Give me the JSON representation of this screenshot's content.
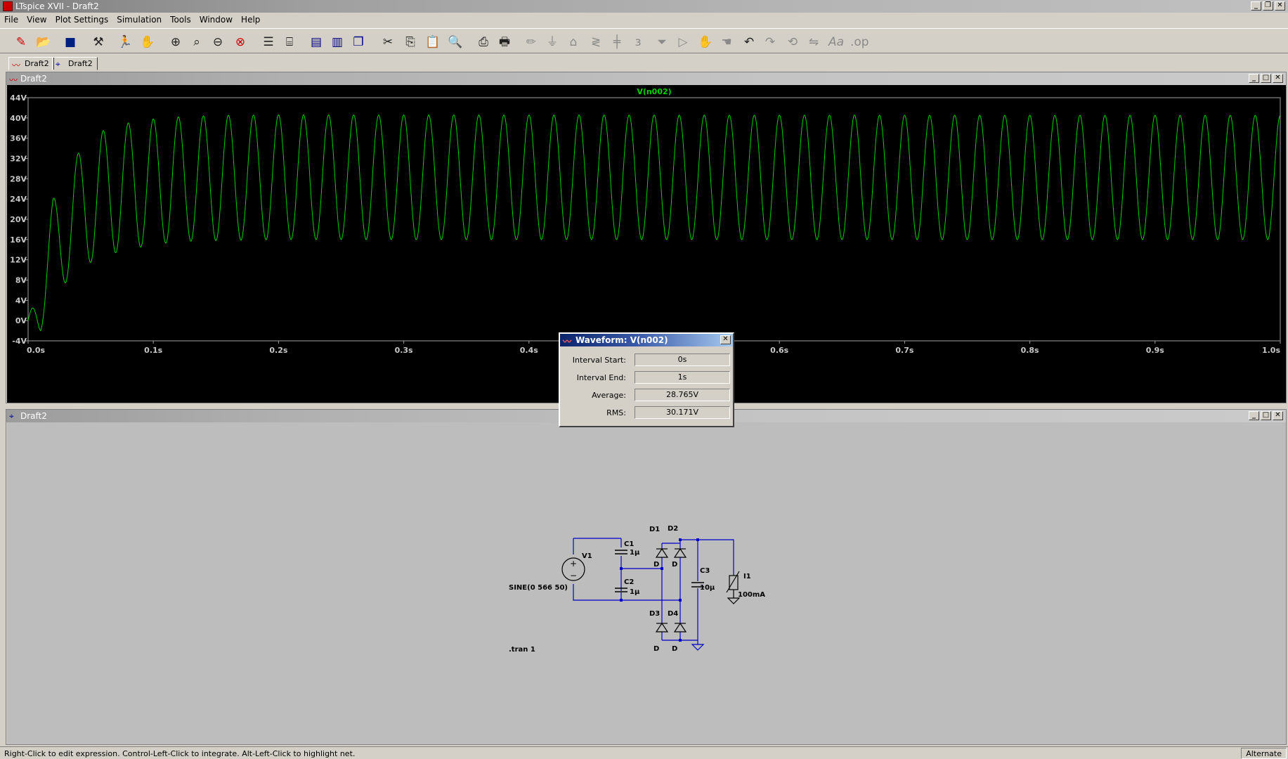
{
  "window": {
    "title": "LTspice XVII - Draft2"
  },
  "menu": [
    "File",
    "View",
    "Plot Settings",
    "Simulation",
    "Tools",
    "Window",
    "Help"
  ],
  "toolbar": {
    "icons": [
      "new-schematic-icon",
      "open-icon",
      "save-icon",
      "control-panel-icon",
      "run-icon",
      "halt-icon",
      "zoom-in-icon",
      "zoom-pan-icon",
      "zoom-out-icon",
      "zoom-cancel-icon",
      "autorange-icon",
      "add-trace-icon",
      "tile-horizontal-icon",
      "tile-vertical-icon",
      "cascade-icon",
      "cut-icon",
      "copy-icon",
      "paste-icon",
      "find-icon",
      "print-setup-icon",
      "print-icon",
      "draw-wire-icon",
      "ground-icon",
      "label-net-icon",
      "resistor-icon",
      "capacitor-icon",
      "inductor-icon",
      "diode-icon",
      "component-icon",
      "move-icon",
      "drag-icon",
      "undo-icon",
      "redo-icon",
      "rotate-icon",
      "mirror-icon",
      "text-icon",
      "spice-directive-icon"
    ]
  },
  "tabs": [
    {
      "label": "Draft2",
      "icon": "waveform-tab-icon"
    },
    {
      "label": "Draft2",
      "icon": "schematic-tab-icon"
    }
  ],
  "plot_pane": {
    "title": "Draft2"
  },
  "schematic_pane": {
    "title": "Draft2"
  },
  "chart_data": {
    "type": "line",
    "title": "V(n002)",
    "xlabel": "",
    "ylabel": "",
    "xlim": [
      0,
      1.0
    ],
    "ylim": [
      -4,
      44
    ],
    "x_ticks": [
      "0.0s",
      "0.1s",
      "0.2s",
      "0.3s",
      "0.4s",
      "0.5s",
      "0.6s",
      "0.7s",
      "0.8s",
      "0.9s",
      "1.0s"
    ],
    "y_ticks": [
      "44V",
      "40V",
      "36V",
      "32V",
      "28V",
      "24V",
      "20V",
      "16V",
      "12V",
      "8V",
      "4V",
      "0V",
      "-4V"
    ],
    "series": [
      {
        "name": "V(n002)",
        "color": "#00d000",
        "frequency_hz": 50,
        "envelope_time_s": [
          0.0,
          0.01,
          0.02,
          0.03,
          0.04,
          0.05,
          0.06,
          0.08,
          0.1,
          0.12,
          0.15,
          0.2,
          1.0
        ],
        "envelope_peak_v": [
          0.0,
          10.5,
          24.0,
          29.5,
          33.0,
          36.0,
          37.5,
          39.0,
          39.8,
          40.2,
          40.5,
          40.6,
          40.5
        ],
        "envelope_trough_v": [
          0.0,
          -2.0,
          4.0,
          7.5,
          10.0,
          11.5,
          12.8,
          14.0,
          15.0,
          15.6,
          15.8,
          16.0,
          16.0
        ]
      }
    ],
    "grid": false,
    "background": "#000000"
  },
  "waveform_dialog": {
    "title": "Waveform: V(n002)",
    "rows": [
      {
        "label": "Interval Start:",
        "value": "0s"
      },
      {
        "label": "Interval End:",
        "value": "1s"
      },
      {
        "label": "Average:",
        "value": "28.765V"
      },
      {
        "label": "RMS:",
        "value": "30.171V"
      }
    ]
  },
  "schematic": {
    "source_name": "V1",
    "source_value": "SINE(0 566 50)",
    "c1": {
      "name": "C1",
      "value": "1µ"
    },
    "c2": {
      "name": "C2",
      "value": "1µ"
    },
    "c3": {
      "name": "C3",
      "value": "10µ"
    },
    "d1": {
      "name": "D1",
      "model": "D"
    },
    "d2": {
      "name": "D2",
      "model": "D"
    },
    "d3": {
      "name": "D3",
      "model": "D"
    },
    "d4": {
      "name": "D4",
      "model": "D"
    },
    "load_name": "I1",
    "load_value": "100mA",
    "directive": ".tran 1",
    "wire_color": "#0000c8"
  },
  "status": {
    "text": "Right-Click to edit expression. Control-Left-Click to integrate. Alt-Left-Click to highlight net.",
    "mode": "Alternate"
  }
}
